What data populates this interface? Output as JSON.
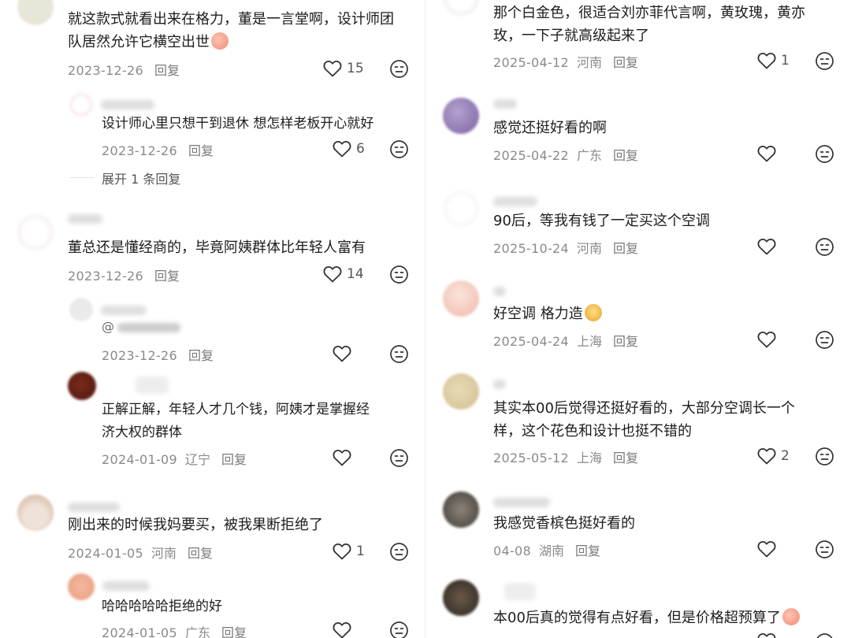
{
  "left_comments": [
    {
      "text": [
        "就这款式就看出来在格力，董是一言堂啊，设计师团",
        "队居然允许它横空出世"
      ],
      "date": "2023-12-26",
      "location": "",
      "reply": "回复",
      "likes": "15",
      "emoji": "peach"
    },
    {
      "text": [
        "设计师心里只想干到退休 想怎样老板开心就好"
      ],
      "date": "2023-12-26",
      "location": "",
      "reply": "回复",
      "likes": "6",
      "expand": "展开 1 条回复"
    },
    {
      "text": [
        "董总还是懂经商的，毕竟阿姨群体比年轻人富有"
      ],
      "date": "2023-12-26",
      "location": "",
      "reply": "回复",
      "likes": "14"
    },
    {
      "text": [],
      "mention": "@",
      "date": "2023-12-26",
      "location": "",
      "reply": "回复",
      "likes": ""
    },
    {
      "text": [
        "正解正解，年轻人才几个钱，阿姨才是掌握经",
        "济大权的群体"
      ],
      "date": "2024-01-09",
      "location": "辽宁",
      "reply": "回复",
      "likes": ""
    },
    {
      "text": [
        "刚出来的时候我妈要买，被我果断拒绝了"
      ],
      "date": "2024-01-05",
      "location": "河南",
      "reply": "回复",
      "likes": "1"
    },
    {
      "text": [
        "哈哈哈哈哈拒绝的好"
      ],
      "date": "2024-01-05",
      "location": "广东",
      "reply": "回复",
      "likes": ""
    }
  ],
  "right_comments": [
    {
      "text": [
        "那个白金色，很适合刘亦菲代言啊，黄玫瑰，黄亦",
        "玫，一下子就高级起来了"
      ],
      "date": "2025-04-12",
      "location": "河南",
      "reply": "回复",
      "likes": "1"
    },
    {
      "text": [
        "感觉还挺好看的啊"
      ],
      "date": "2025-04-22",
      "location": "广东",
      "reply": "回复",
      "likes": ""
    },
    {
      "text": [
        "90后，等我有钱了一定买这个空调"
      ],
      "date": "2025-10-24",
      "location": "河南",
      "reply": "回复",
      "likes": ""
    },
    {
      "text": [
        "好空调 格力造"
      ],
      "date": "2025-04-24",
      "location": "上海",
      "reply": "回复",
      "likes": "",
      "emoji": "monkey"
    },
    {
      "text": [
        "其实本00后觉得还挺好看的，大部分空调长一个",
        "样，这个花色和设计也挺不错的"
      ],
      "date": "2025-05-12",
      "location": "上海",
      "reply": "回复",
      "likes": "2"
    },
    {
      "text": [
        "我感觉香槟色挺好看的"
      ],
      "date": "04-08",
      "location": "湖南",
      "reply": "回复",
      "likes": ""
    },
    {
      "text": [
        "本00后真的觉得有点好看，但是价格超预算了"
      ],
      "date": "",
      "location": "",
      "reply": "",
      "likes": "",
      "emoji": "peach"
    }
  ]
}
